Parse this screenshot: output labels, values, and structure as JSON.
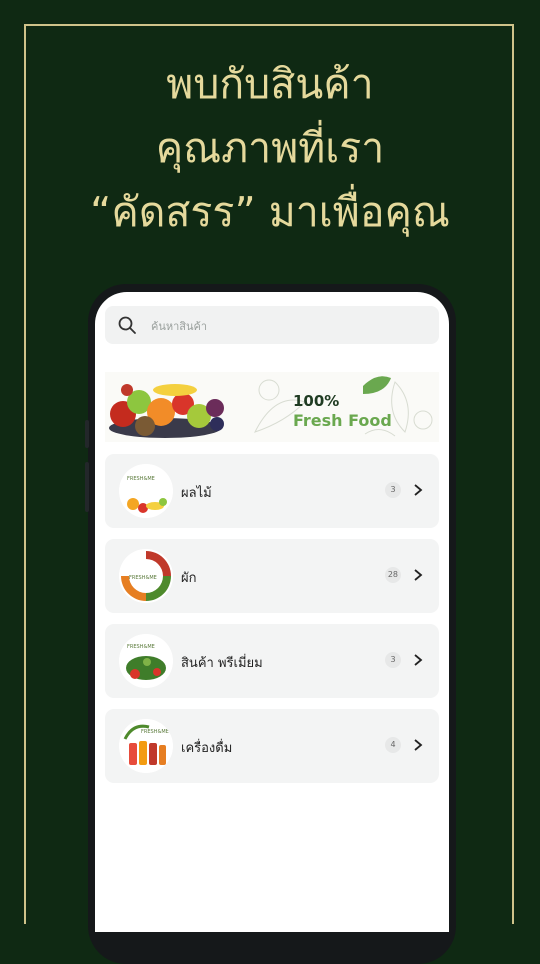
{
  "headline": {
    "line1": "พบกับสินค้า",
    "line2": "คุณภาพที่เรา",
    "line3": "“คัดสรร” มาเพื่อคุณ"
  },
  "search": {
    "placeholder": "ค้นหาสินค้า",
    "icon": "search-icon"
  },
  "banner": {
    "percent_text": "100%",
    "fresh_text": "Fresh Food"
  },
  "categories": [
    {
      "label": "ผลไม้",
      "count": "3",
      "thumb_caption": "FRESH&ME"
    },
    {
      "label": "ผัก",
      "count": "28",
      "thumb_caption": "FRESH&ME"
    },
    {
      "label": "สินค้า พรีเมี่ยม",
      "count": "3",
      "thumb_caption": "FRESH&ME"
    },
    {
      "label": "เครื่องดื่ม",
      "count": "4",
      "thumb_caption": "FRESH&ME"
    }
  ],
  "colors": {
    "background": "#0f2913",
    "headline": "#e5d99c",
    "frame": "#cfc38a",
    "brand_green": "#6aa84f"
  }
}
